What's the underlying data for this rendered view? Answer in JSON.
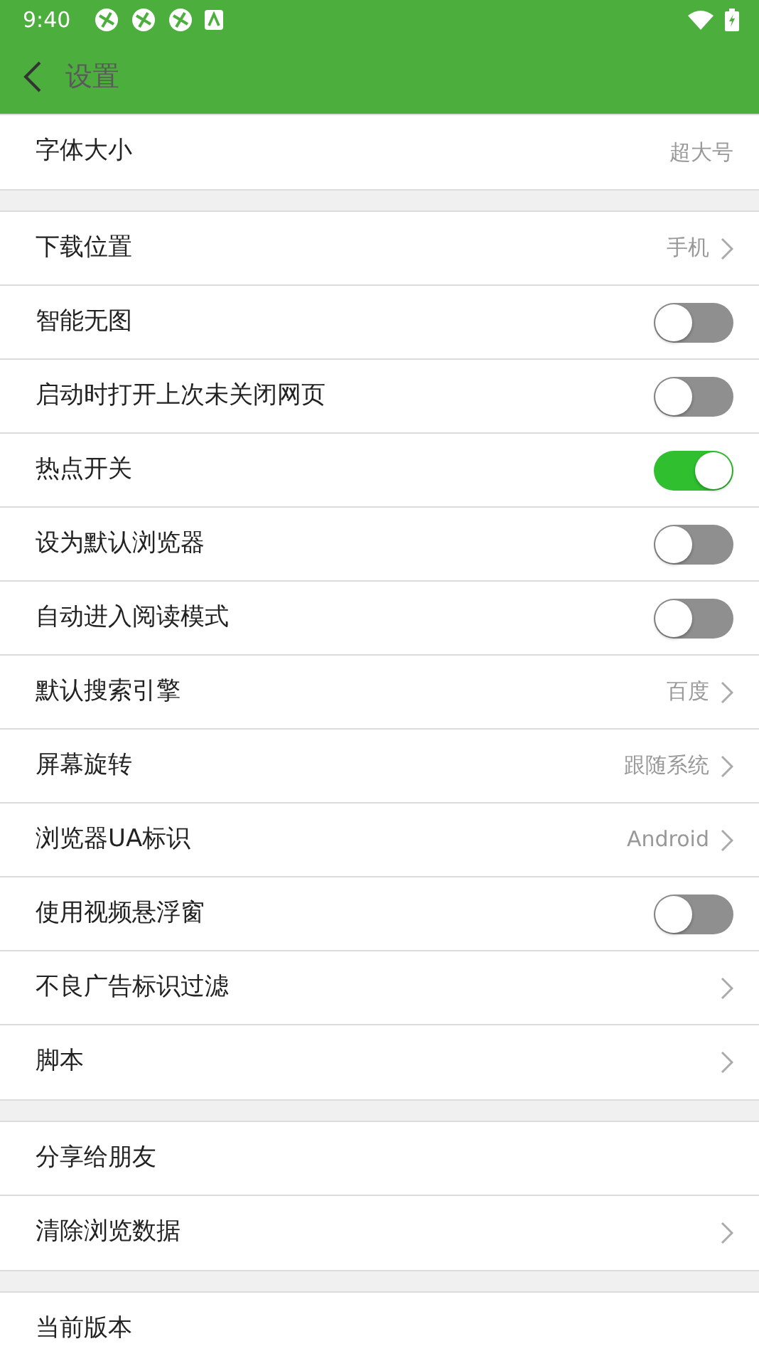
{
  "status_bar": {
    "time": "9:40"
  },
  "header": {
    "title": "设置"
  },
  "groups": [
    {
      "rows": [
        {
          "kind": "value",
          "label": "字体大小",
          "value": "超大号"
        }
      ]
    },
    {
      "rows": [
        {
          "kind": "link",
          "label": "下载位置",
          "value": "手机"
        },
        {
          "kind": "switch",
          "label": "智能无图",
          "on": false
        },
        {
          "kind": "switch",
          "label": "启动时打开上次未关闭网页",
          "on": false
        },
        {
          "kind": "switch",
          "label": "热点开关",
          "on": true
        },
        {
          "kind": "switch",
          "label": "设为默认浏览器",
          "on": false
        },
        {
          "kind": "switch",
          "label": "自动进入阅读模式",
          "on": false
        },
        {
          "kind": "link",
          "label": "默认搜索引擎",
          "value": "百度"
        },
        {
          "kind": "link",
          "label": "屏幕旋转",
          "value": "跟随系统"
        },
        {
          "kind": "link",
          "label": "浏览器UA标识",
          "value": "Android"
        },
        {
          "kind": "switch",
          "label": "使用视频悬浮窗",
          "on": false
        },
        {
          "kind": "link",
          "label": "不良广告标识过滤"
        },
        {
          "kind": "link",
          "label": "脚本"
        }
      ]
    },
    {
      "rows": [
        {
          "kind": "plain",
          "label": "分享给朋友"
        },
        {
          "kind": "link",
          "label": "清除浏览数据"
        }
      ]
    },
    {
      "rows": [
        {
          "kind": "plain",
          "label": "当前版本"
        }
      ]
    }
  ]
}
